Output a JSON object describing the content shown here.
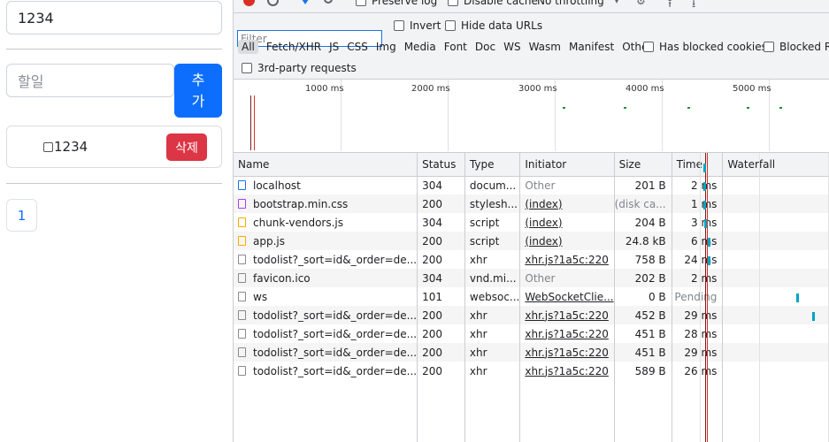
{
  "app": {
    "top_input_value": "1234",
    "todo_input_placeholder": "할일",
    "add_button_line1": "추",
    "add_button_line2": "가",
    "todo_item_text": "1234",
    "delete_button_label": "삭제",
    "page_number": "1"
  },
  "devtools": {
    "toolbar": {
      "preserve_log": "Preserve log",
      "disable_cache": "Disable cache",
      "throttling": "No throttling"
    },
    "filter": {
      "placeholder": "Filter",
      "invert": "Invert",
      "hide_data_urls": "Hide data URLs"
    },
    "types": [
      "All",
      "Fetch/XHR",
      "JS",
      "CSS",
      "Img",
      "Media",
      "Font",
      "Doc",
      "WS",
      "Wasm",
      "Manifest",
      "Other"
    ],
    "has_blocked_cookies": "Has blocked cookies",
    "blocked_requests": "Blocked Re",
    "third_party": "3rd-party requests",
    "overview_ticks": [
      "1000 ms",
      "2000 ms",
      "3000 ms",
      "4000 ms",
      "5000 ms"
    ],
    "columns": [
      "Name",
      "Status",
      "Type",
      "Initiator",
      "Size",
      "Time",
      "Waterfall"
    ],
    "rows": [
      {
        "name": "localhost",
        "status": "304",
        "type": "docum...",
        "initiator": "Other",
        "size": "201 B",
        "time": "2 ms",
        "icon": "document-icon"
      },
      {
        "name": "bootstrap.min.css",
        "status": "200",
        "type": "stylesh...",
        "initiator": "(index)",
        "size": "(disk ca...",
        "time": "1 ms",
        "icon": "stylesheet-icon"
      },
      {
        "name": "chunk-vendors.js",
        "status": "304",
        "type": "script",
        "initiator": "(index)",
        "size": "204 B",
        "time": "3 ms",
        "icon": "script-icon"
      },
      {
        "name": "app.js",
        "status": "200",
        "type": "script",
        "initiator": "(index)",
        "size": "24.8 kB",
        "time": "6 ms",
        "icon": "script-icon"
      },
      {
        "name": "todolist?_sort=id&_order=de...",
        "status": "200",
        "type": "xhr",
        "initiator": "xhr.js?1a5c:220",
        "size": "758 B",
        "time": "24 ms",
        "icon": "file-icon"
      },
      {
        "name": "favicon.ico",
        "status": "304",
        "type": "vnd.mi...",
        "initiator": "Other",
        "size": "202 B",
        "time": "2 ms",
        "icon": "file-icon"
      },
      {
        "name": "ws",
        "status": "101",
        "type": "websoc...",
        "initiator": "WebSocketClie...",
        "size": "0 B",
        "time": "Pending",
        "icon": "file-icon"
      },
      {
        "name": "todolist?_sort=id&_order=de...",
        "status": "200",
        "type": "xhr",
        "initiator": "xhr.js?1a5c:220",
        "size": "452 B",
        "time": "29 ms",
        "icon": "file-icon"
      },
      {
        "name": "todolist?_sort=id&_order=de...",
        "status": "200",
        "type": "xhr",
        "initiator": "xhr.js?1a5c:220",
        "size": "451 B",
        "time": "28 ms",
        "icon": "file-icon"
      },
      {
        "name": "todolist?_sort=id&_order=de...",
        "status": "200",
        "type": "xhr",
        "initiator": "xhr.js?1a5c:220",
        "size": "451 B",
        "time": "29 ms",
        "icon": "file-icon"
      },
      {
        "name": "todolist?_sort=id&_order=de...",
        "status": "200",
        "type": "xhr",
        "initiator": "xhr.js?1a5c:220",
        "size": "589 B",
        "time": "26 ms",
        "icon": "file-icon"
      }
    ],
    "colors": {
      "record": "#d93025",
      "accent": "#1a73e8",
      "waterfall_bar": "#00a4c4"
    }
  }
}
